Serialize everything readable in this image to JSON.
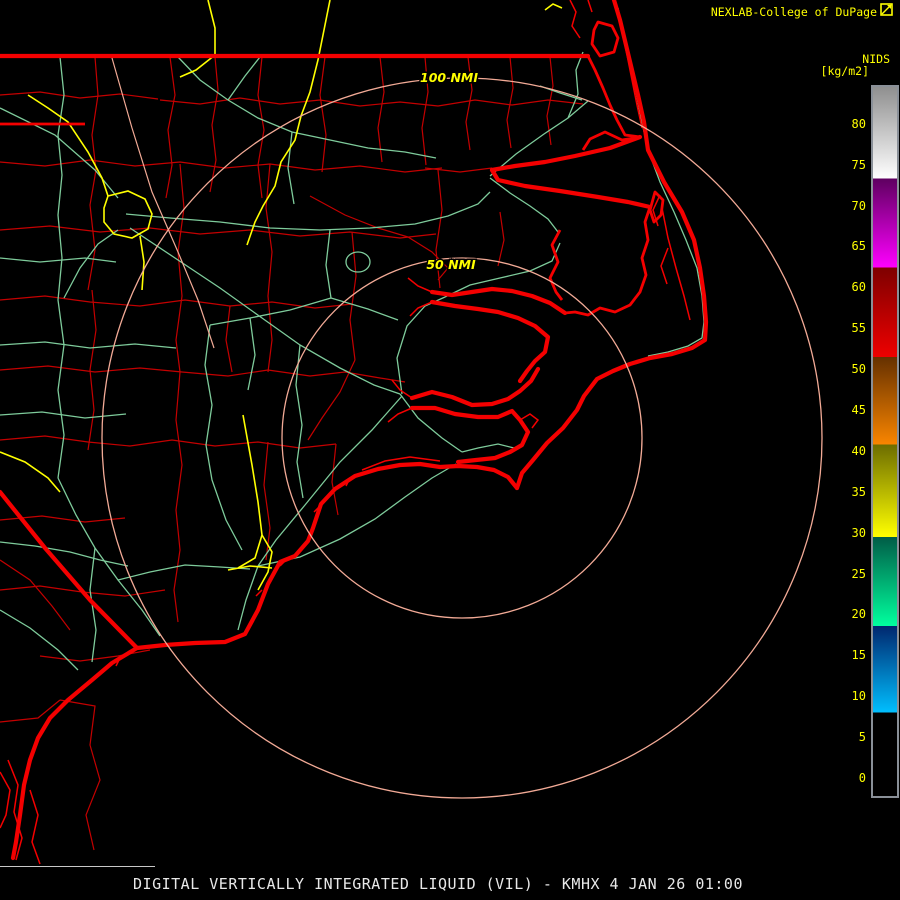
{
  "header": {
    "title": "NEXLAB-College of DuPage",
    "logo_icon": "cod-logo"
  },
  "scale": {
    "product_label": "NIDS",
    "units_label": "[kg/m2]",
    "ticks": [
      80,
      75,
      70,
      65,
      60,
      55,
      50,
      45,
      40,
      35,
      30,
      25,
      20,
      15,
      10,
      5,
      0
    ],
    "value_top": 84.5,
    "value_bottom": -2.2,
    "segments": [
      {
        "from": 84.5,
        "to": 73.3,
        "color_start": "#8f8f8f",
        "color_end": "#ffffff"
      },
      {
        "from": 73.3,
        "to": 62.4,
        "color_start": "#5e0060",
        "color_end": "#ff00ff"
      },
      {
        "from": 62.4,
        "to": 51.5,
        "color_start": "#7e0000",
        "color_end": "#ee0000"
      },
      {
        "from": 51.5,
        "to": 40.8,
        "color_start": "#653000",
        "color_end": "#f98500"
      },
      {
        "from": 40.8,
        "to": 29.5,
        "color_start": "#6c6c00",
        "color_end": "#ffff00"
      },
      {
        "from": 29.5,
        "to": 18.6,
        "color_start": "#005c46",
        "color_end": "#00ff9e"
      },
      {
        "from": 18.6,
        "to": 8.0,
        "color_start": "#00276e",
        "color_end": "#00bfff"
      },
      {
        "from": 8.0,
        "to": -2.2,
        "color_start": "#000000",
        "color_end": "#000000"
      }
    ]
  },
  "rings": {
    "outer_label": "100 NMI",
    "inner_label": "50 NMI"
  },
  "footer": {
    "title": "DIGITAL VERTICALLY INTEGRATED LIQUID (VIL) - KMHX 4 JAN 26 01:00"
  },
  "colors": {
    "label_yellow": "#ffff00",
    "boundary_red": "#f40000",
    "county_red": "#c40000",
    "road_green": "#7ecb9b",
    "road_yellow": "#ffff00",
    "ring_salmon": "#f2aa96",
    "cbar_border": "#8a9098",
    "title_white": "#e8e8e8"
  }
}
